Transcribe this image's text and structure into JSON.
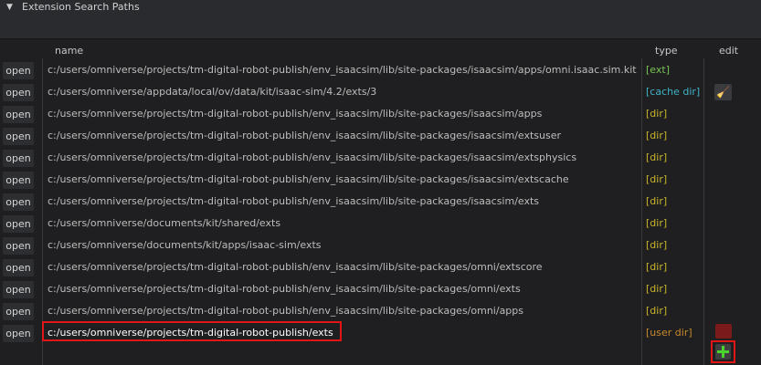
{
  "section": {
    "arrow": "▼",
    "title": "Extension Search Paths"
  },
  "columns": {
    "name": "name",
    "type": "type",
    "edit": "edit"
  },
  "open_label": "open",
  "rows": [
    {
      "path": "c:/users/omniverse/projects/tm-digital-robot-publish/env_isaacsim/lib/site-packages/isaacsim/apps/omni.isaac.sim.kit",
      "type": "[ext]"
    },
    {
      "path": "c:/users/omniverse/appdata/local/ov/data/kit/isaac-sim/4.2/exts/3",
      "type": "[cache dir]"
    },
    {
      "path": "c:/users/omniverse/projects/tm-digital-robot-publish/env_isaacsim/lib/site-packages/isaacsim/apps",
      "type": "[dir]"
    },
    {
      "path": "c:/users/omniverse/projects/tm-digital-robot-publish/env_isaacsim/lib/site-packages/isaacsim/extsuser",
      "type": "[dir]"
    },
    {
      "path": "c:/users/omniverse/projects/tm-digital-robot-publish/env_isaacsim/lib/site-packages/isaacsim/extsphysics",
      "type": "[dir]"
    },
    {
      "path": "c:/users/omniverse/projects/tm-digital-robot-publish/env_isaacsim/lib/site-packages/isaacsim/extscache",
      "type": "[dir]"
    },
    {
      "path": "c:/users/omniverse/projects/tm-digital-robot-publish/env_isaacsim/lib/site-packages/isaacsim/exts",
      "type": "[dir]"
    },
    {
      "path": "c:/users/omniverse/documents/kit/shared/exts",
      "type": "[dir]"
    },
    {
      "path": "c:/users/omniverse/documents/kit/apps/isaac-sim/exts",
      "type": "[dir]"
    },
    {
      "path": "c:/users/omniverse/projects/tm-digital-robot-publish/env_isaacsim/lib/site-packages/omni/extscore",
      "type": "[dir]"
    },
    {
      "path": "c:/users/omniverse/projects/tm-digital-robot-publish/env_isaacsim/lib/site-packages/omni/exts",
      "type": "[dir]"
    },
    {
      "path": "c:/users/omniverse/projects/tm-digital-robot-publish/env_isaacsim/lib/site-packages/omni/apps",
      "type": "[dir]"
    },
    {
      "path": "c:/users/omniverse/projects/tm-digital-robot-publish/exts",
      "type": "[user dir]"
    }
  ],
  "icons": {
    "clear_cache": "broom-icon",
    "remove": "remove-icon",
    "add": "plus-icon"
  },
  "colors": {
    "ext": "#79c255",
    "cache_dir": "#3fb3c6",
    "dir": "#c8b42a",
    "user_dir": "#c78a2c",
    "highlight": "#e01515",
    "add": "#4bd32e"
  }
}
